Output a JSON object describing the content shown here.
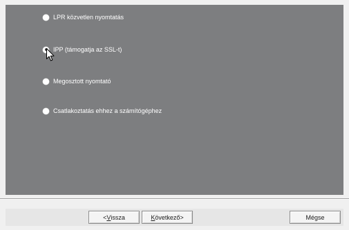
{
  "options": [
    {
      "label": "LPR közvetlen nyomtatás",
      "selected": false
    },
    {
      "label": "IPP (támogatja az SSL-t)",
      "selected": true
    },
    {
      "label": "Megosztott nyomtató",
      "selected": false
    },
    {
      "label": "Csatlakoztatás ehhez a számítógéphez",
      "selected": false
    }
  ],
  "buttons": {
    "back": {
      "prefix": "< ",
      "accel": "V",
      "rest": "issza"
    },
    "next": {
      "accel": "K",
      "rest": "övetkező",
      "suffix": " >"
    },
    "cancel": "Mégse"
  },
  "icons": {
    "radio": "radio-button",
    "cursor": "mouse-pointer-arrow"
  },
  "colors": {
    "panel_background": "#7d7e80",
    "dialog_background": "#f0f0f0",
    "option_text": "#ffffff"
  }
}
